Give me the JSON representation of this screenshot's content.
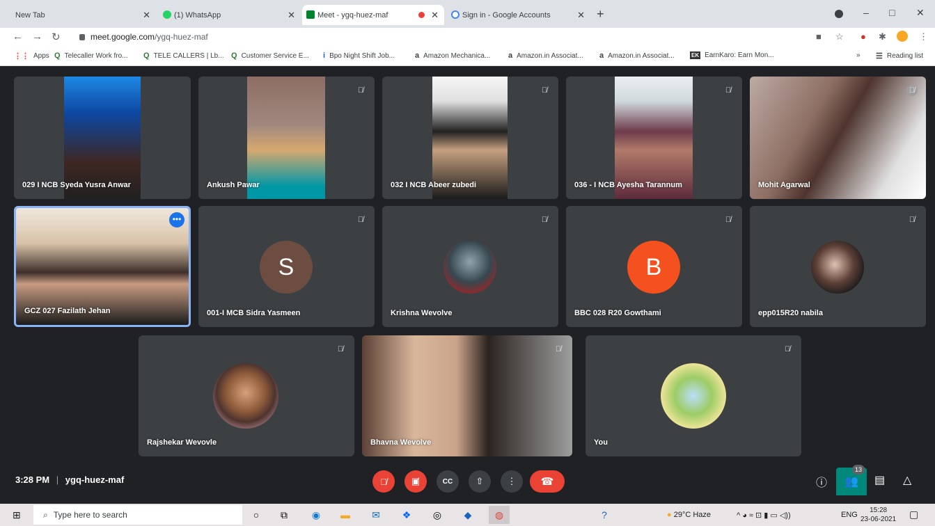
{
  "browser": {
    "tabs": [
      {
        "title": "New Tab"
      },
      {
        "title": "(1) WhatsApp"
      },
      {
        "title": "Meet - ygq-huez-maf"
      },
      {
        "title": "Sign in - Google Accounts"
      }
    ],
    "url_host": "meet.google.com",
    "url_path": "/ygq-huez-maf",
    "bookmarks": [
      {
        "icon": "A",
        "label": "Apps"
      },
      {
        "icon": "Q",
        "label": "Telecaller Work fro..."
      },
      {
        "icon": "Q",
        "label": "TELE CALLERS | Lb..."
      },
      {
        "icon": "Q",
        "label": "Customer Service E..."
      },
      {
        "icon": "i",
        "label": "Bpo Night Shift Job..."
      },
      {
        "icon": "a",
        "label": "Amazon Mechanica..."
      },
      {
        "icon": "a",
        "label": "Amazon.in Associat..."
      },
      {
        "icon": "a",
        "label": "Amazon.in Associat..."
      },
      {
        "icon": "EK",
        "label": "EarnKaro: Earn Mon..."
      }
    ],
    "reading_list": "Reading list",
    "more_bookmarks": "»"
  },
  "meet": {
    "participants": [
      {
        "name": "029 I NCB Syeda Yusra Anwar",
        "kind": "video",
        "muted": false
      },
      {
        "name": "Ankush Pawar",
        "kind": "video",
        "muted": true
      },
      {
        "name": "032 I NCB Abeer zubedi",
        "kind": "video",
        "muted": true
      },
      {
        "name": "036 - I NCB Ayesha Tarannum",
        "kind": "video",
        "muted": true
      },
      {
        "name": "Mohit Agarwal",
        "kind": "video",
        "muted": true
      },
      {
        "name": "GCZ 027 Fazilath Jehan",
        "kind": "video",
        "muted": false,
        "selected": true
      },
      {
        "name": "001-I MCB Sidra Yasmeen",
        "kind": "letter",
        "letter": "S",
        "color": "#6d4c41",
        "muted": true
      },
      {
        "name": "Krishna Wevolve",
        "kind": "photo",
        "muted": true
      },
      {
        "name": "BBC 028 R20 Gowthami",
        "kind": "letter",
        "letter": "B",
        "color": "#f4511e",
        "muted": true
      },
      {
        "name": "epp015R20 nabila",
        "kind": "photo",
        "muted": true
      },
      {
        "name": "Rajshekar Wevovle",
        "kind": "photo",
        "muted": true
      },
      {
        "name": "Bhavna Wevolve",
        "kind": "video",
        "muted": true
      },
      {
        "name": "You",
        "kind": "photo",
        "muted": true
      }
    ],
    "time": "3:28 PM",
    "separator": "|",
    "meeting_code": "ygq-huez-maf",
    "people_count": "13"
  },
  "taskbar": {
    "search_placeholder": "Type here to search",
    "weather": "29°C  Haze",
    "language": "ENG",
    "time": "15:28",
    "date": "23-06-2021"
  }
}
